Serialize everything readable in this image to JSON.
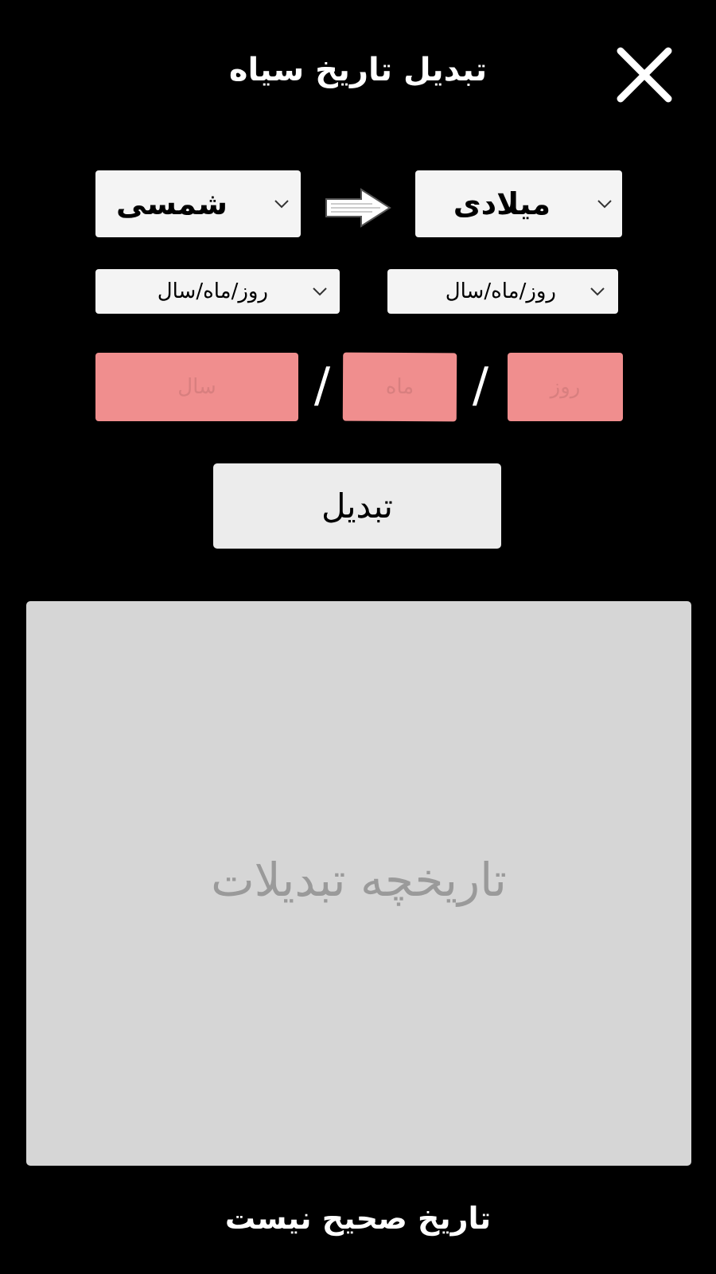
{
  "header": {
    "title": "تبدیل تاریخ سیاه",
    "close_icon": "close-icon"
  },
  "conversion": {
    "to_calendar": "میلادی",
    "from_calendar": "شمسی",
    "direction_icon": "arrow-right-icon",
    "to_format": "روز/ماه/سال",
    "from_format": "روز/ماه/سال"
  },
  "date_inputs": {
    "day_placeholder": "روز",
    "month_placeholder": "ماه",
    "year_placeholder": "سال",
    "separator": "/",
    "day_value": "",
    "month_value": "",
    "year_value": ""
  },
  "actions": {
    "convert_label": "تبدیل"
  },
  "history": {
    "placeholder": "تاریخچه تبدیلات"
  },
  "status": {
    "message": "تاریخ صحیح نیست"
  },
  "colors": {
    "background": "#000000",
    "invalid_field": "#f08e8e",
    "select_bg": "#f4f4f4",
    "button_bg": "#ececec",
    "history_bg": "#d6d6d6"
  }
}
